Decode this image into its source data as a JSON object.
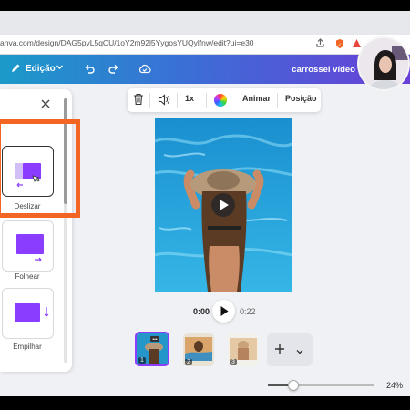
{
  "browser": {
    "url": "anva.com/design/DAG5pyL5qCU/1oY2m92l5YygosYUQylfnw/edit?ui=e30"
  },
  "topbar": {
    "edit_label": "Edição",
    "title": "carrossel vídeo"
  },
  "toolbar": {
    "speed_label": "1x",
    "animate_label": "Animar",
    "position_label": "Posição"
  },
  "panel": {
    "animations": [
      {
        "label": "Deslizar"
      },
      {
        "label": "Folhear"
      },
      {
        "label": "Empilhar"
      }
    ],
    "scroll_fraction": 0.4
  },
  "player": {
    "current_time": "0:00",
    "total_time": "0:22"
  },
  "pages": [
    {
      "number": "1"
    },
    {
      "number": "2"
    },
    {
      "number": "3"
    }
  ],
  "zoom": {
    "label": "24%",
    "fraction": 0.24
  },
  "colors": {
    "accent": "#8b3dff",
    "highlight": "#f26522",
    "topbar_start": "#1b9ac9",
    "topbar_end": "#6a3fd8"
  }
}
